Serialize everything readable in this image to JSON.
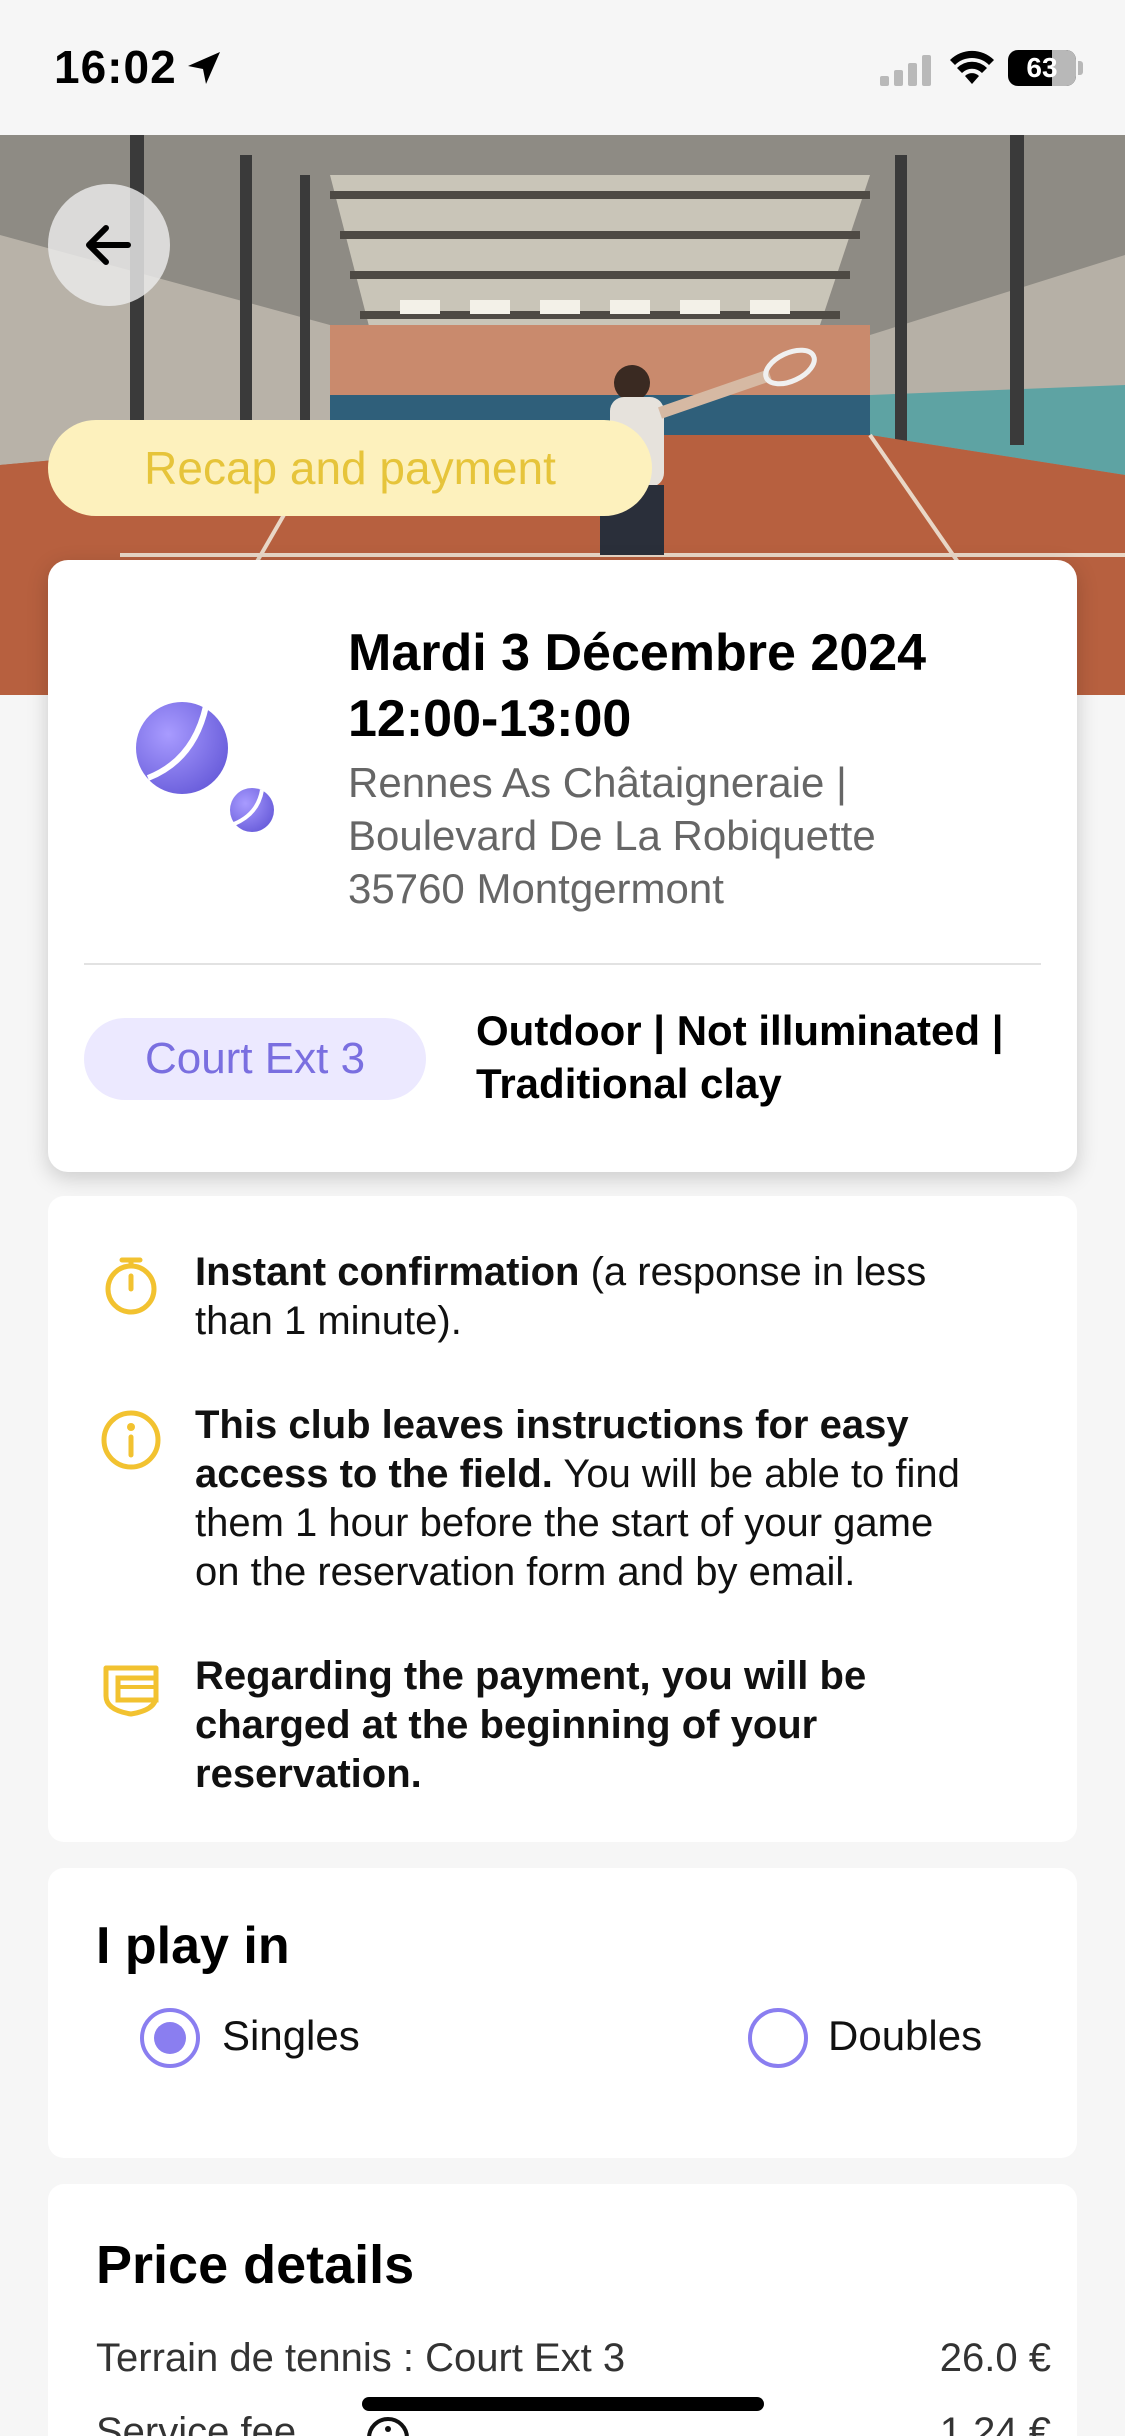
{
  "status_bar": {
    "time": "16:02",
    "battery": "63",
    "icons": [
      "location-arrow-icon",
      "signal-icon",
      "wifi-icon",
      "battery-icon"
    ]
  },
  "header": {
    "back_icon": "arrow-left-icon",
    "title_pill": "Recap and payment"
  },
  "booking": {
    "date": "Mardi 3 Décembre 2024",
    "time": "12:00-13:00",
    "address_line1": "Rennes As Châtaigneraie |",
    "address_line2": "Boulevard De La Robiquette",
    "address_line3": "35760 Montgermont",
    "court": "Court Ext 3",
    "court_details_line1": "Outdoor | Not illuminated |",
    "court_details_line2": "Traditional clay",
    "icon": "tennis-balls-icon"
  },
  "info": {
    "items": [
      {
        "icon": "stopwatch-icon",
        "bold": "Instant confirmation",
        "text_line1": " (a response in less",
        "text_line2": "than 1 minute)."
      },
      {
        "icon": "info-circle-icon",
        "bold_line1": "This club leaves instructions for easy",
        "bold_line2": "access to the field.",
        "text_line2": " You will be able to find",
        "text_line3": "them 1 hour before the start of your game",
        "text_line4": "on the reservation form and by email."
      },
      {
        "icon": "payment-card-icon",
        "bold_line1": "Regarding the payment, you will be",
        "bold_line2": "charged at the beginning of your",
        "bold_line3": "reservation."
      }
    ]
  },
  "play_in": {
    "title": "I play in",
    "options": [
      {
        "label": "Singles",
        "selected": true
      },
      {
        "label": "Doubles",
        "selected": false
      }
    ]
  },
  "price": {
    "title": "Price details",
    "rows": [
      {
        "label": "Terrain de tennis : Court Ext 3",
        "value": "26.0 €"
      },
      {
        "label": "Service fee",
        "value": "1.24 €"
      }
    ]
  },
  "colors": {
    "accent": "#8a7ef0",
    "pill_bg": "#fdf1bd",
    "pill_text": "#e6c43a",
    "icon_yellow": "#f2c230",
    "court_badge_bg": "#ece9ff"
  }
}
